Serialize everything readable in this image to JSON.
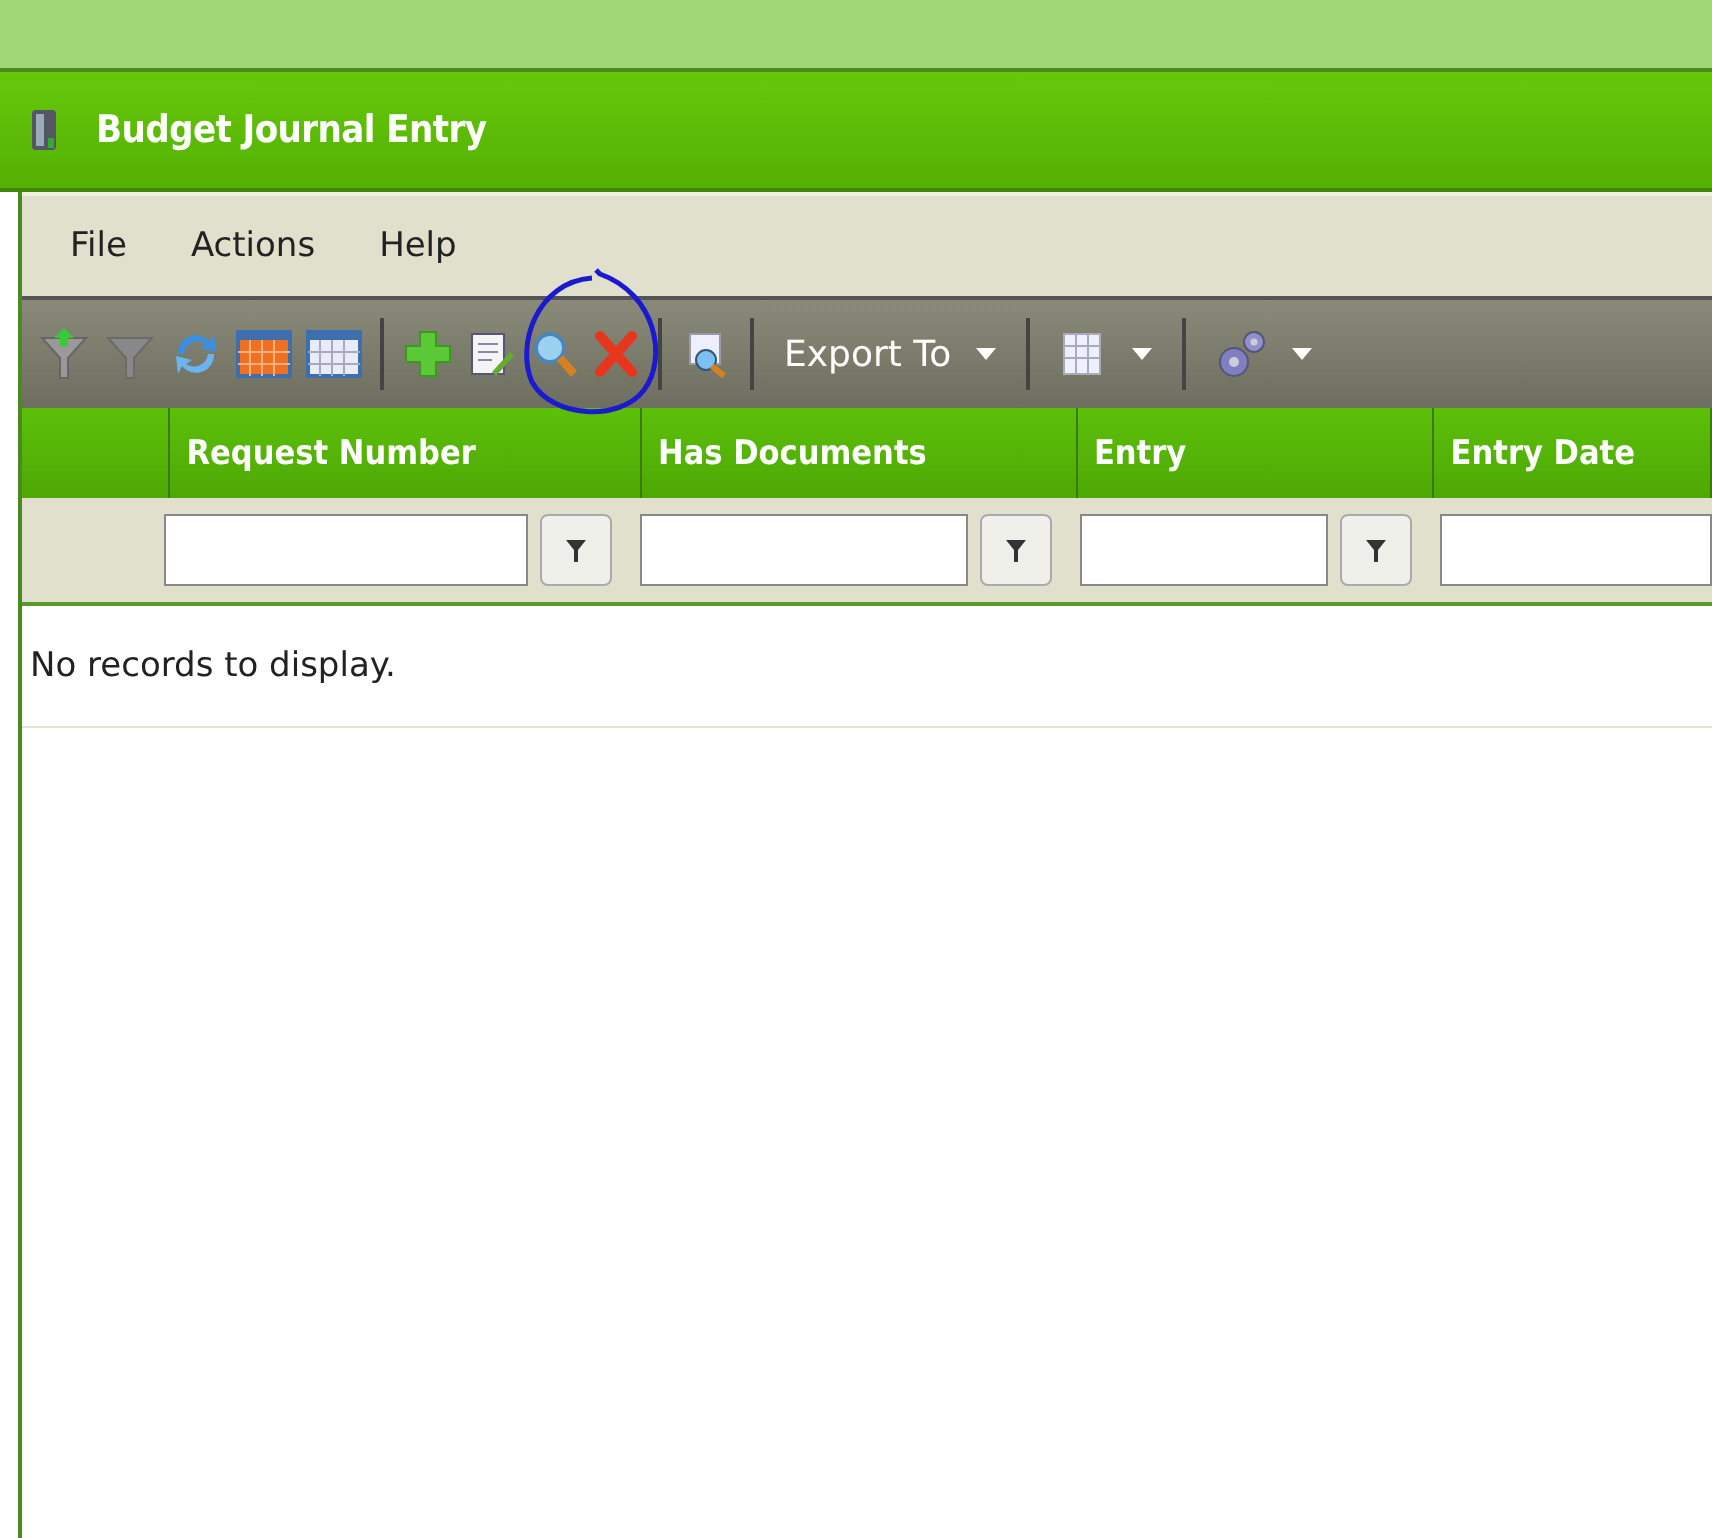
{
  "window": {
    "title": "Budget Journal Entry"
  },
  "menu": [
    "File",
    "Actions",
    "Help"
  ],
  "toolbar": {
    "export_label": "Export To"
  },
  "table": {
    "columns": [
      "Request Number",
      "Has Documents",
      "Entry",
      "Entry Date"
    ],
    "empty_message": "No records to display."
  }
}
